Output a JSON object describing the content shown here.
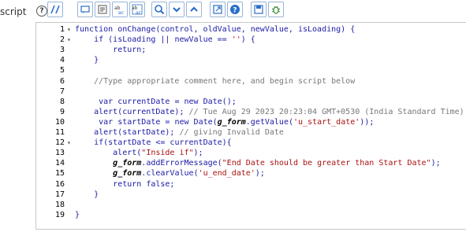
{
  "field": {
    "label": "script",
    "help": "?"
  },
  "toolbar": {
    "buttons": [
      "toggle-syntax-editor-icon",
      "comment-icon",
      "format-icon",
      "replace-icon",
      "replace-all-icon",
      "search-icon",
      "search-next-icon",
      "search-prev-icon",
      "fullscreen-icon",
      "help-icon",
      "save-icon",
      "script-debugger-icon"
    ]
  },
  "editor": {
    "lines": [
      {
        "n": "1",
        "fold": "▾",
        "code": [
          [
            "kw",
            "function "
          ],
          [
            "pl",
            "onChange(control, oldValue, newValue, isLoading) {"
          ]
        ]
      },
      {
        "n": "2",
        "fold": "▾",
        "code": [
          [
            "pl",
            "    "
          ],
          [
            "kw",
            "if "
          ],
          [
            "pl",
            "(isLoading || newValue == "
          ],
          [
            "str",
            "''"
          ],
          [
            "pl",
            ") {"
          ]
        ]
      },
      {
        "n": "3",
        "fold": "",
        "code": [
          [
            "pl",
            "        "
          ],
          [
            "kw",
            "return"
          ],
          [
            "pl",
            ";"
          ]
        ]
      },
      {
        "n": "4",
        "fold": "",
        "code": [
          [
            "pl",
            "    }"
          ]
        ]
      },
      {
        "n": "5",
        "fold": "",
        "code": []
      },
      {
        "n": "6",
        "fold": "",
        "code": [
          [
            "cm",
            "    //Type appropriate comment here, and begin script below"
          ]
        ]
      },
      {
        "n": "7",
        "fold": "",
        "code": []
      },
      {
        "n": "8",
        "fold": "",
        "code": [
          [
            "pl",
            "     "
          ],
          [
            "kw",
            "var "
          ],
          [
            "pl",
            "currentDate = "
          ],
          [
            "kw",
            "new "
          ],
          [
            "pl",
            "Date();"
          ]
        ]
      },
      {
        "n": "9",
        "fold": "",
        "code": [
          [
            "pl",
            "    alert(currentDate); "
          ],
          [
            "cm",
            "// Tue Aug 29 2023 20:23:04 GMT+0530 (India Standard Time)"
          ]
        ]
      },
      {
        "n": "10",
        "fold": "",
        "code": [
          [
            "pl",
            "     "
          ],
          [
            "kw",
            "var "
          ],
          [
            "pl",
            "startDate = "
          ],
          [
            "kw",
            "new "
          ],
          [
            "pl",
            "Date("
          ],
          [
            "it",
            "g_form"
          ],
          [
            "pl",
            ".getValue("
          ],
          [
            "str",
            "'u_start_date'"
          ],
          [
            "pl",
            "));"
          ]
        ]
      },
      {
        "n": "11",
        "fold": "",
        "code": [
          [
            "pl",
            "    alert(startDate); "
          ],
          [
            "cm",
            "// giving Invalid Date"
          ]
        ]
      },
      {
        "n": "12",
        "fold": "▾",
        "code": [
          [
            "pl",
            "    "
          ],
          [
            "kw",
            "if"
          ],
          [
            "pl",
            "(startDate <= currentDate){"
          ]
        ]
      },
      {
        "n": "13",
        "fold": "",
        "code": [
          [
            "pl",
            "        alert("
          ],
          [
            "str",
            "\"Inside if\""
          ],
          [
            "pl",
            ");"
          ]
        ]
      },
      {
        "n": "14",
        "fold": "",
        "code": [
          [
            "pl",
            "        "
          ],
          [
            "it",
            "g_form"
          ],
          [
            "pl",
            ".addErrorMessage("
          ],
          [
            "str",
            "\"End Date should be greater than Start Date\""
          ],
          [
            "pl",
            ");"
          ]
        ]
      },
      {
        "n": "15",
        "fold": "",
        "code": [
          [
            "pl",
            "        "
          ],
          [
            "it",
            "g_form"
          ],
          [
            "pl",
            ".clearValue("
          ],
          [
            "str",
            "'u_end_date'"
          ],
          [
            "pl",
            ");"
          ]
        ]
      },
      {
        "n": "16",
        "fold": "",
        "code": [
          [
            "pl",
            "        "
          ],
          [
            "kw",
            "return "
          ],
          [
            "pl",
            "false;"
          ]
        ]
      },
      {
        "n": "17",
        "fold": "",
        "code": [
          [
            "pl",
            "    }"
          ]
        ]
      },
      {
        "n": "18",
        "fold": "",
        "code": []
      },
      {
        "n": "19",
        "fold": "",
        "code": [
          [
            "pl",
            "}"
          ]
        ]
      }
    ]
  }
}
